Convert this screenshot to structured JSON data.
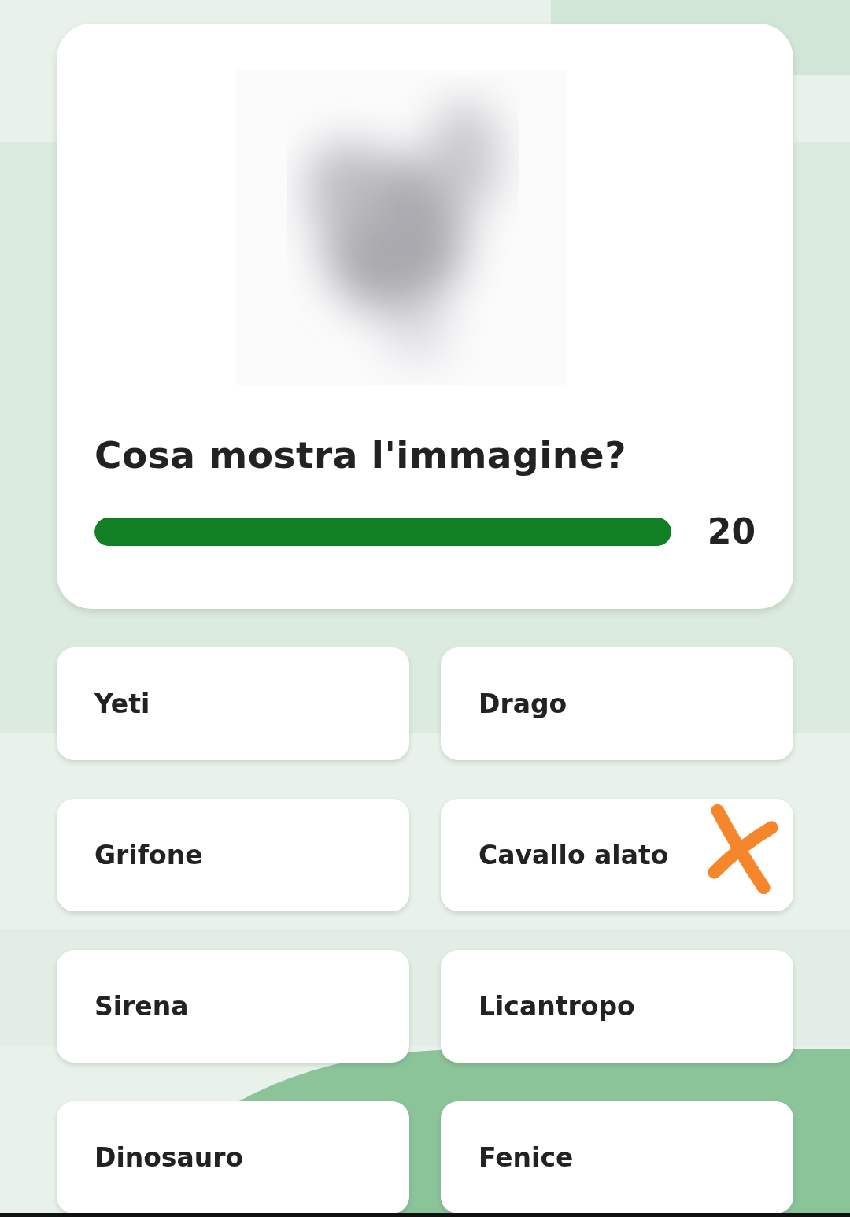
{
  "question": {
    "text": "Cosa mostra l'immagine?",
    "timer": {
      "level": 1,
      "reading": "20"
    }
  },
  "options": [
    {
      "label": "Yeti",
      "marked": false
    },
    {
      "label": "Drago",
      "marked": false
    },
    {
      "label": "Grifone",
      "marked": false
    },
    {
      "label": "Cavallo alato",
      "marked": true
    },
    {
      "label": "Sirena",
      "marked": false
    },
    {
      "label": "Licantropo",
      "marked": false
    },
    {
      "label": "Dinosauro",
      "marked": false
    },
    {
      "label": "Fenice",
      "marked": false
    }
  ]
}
